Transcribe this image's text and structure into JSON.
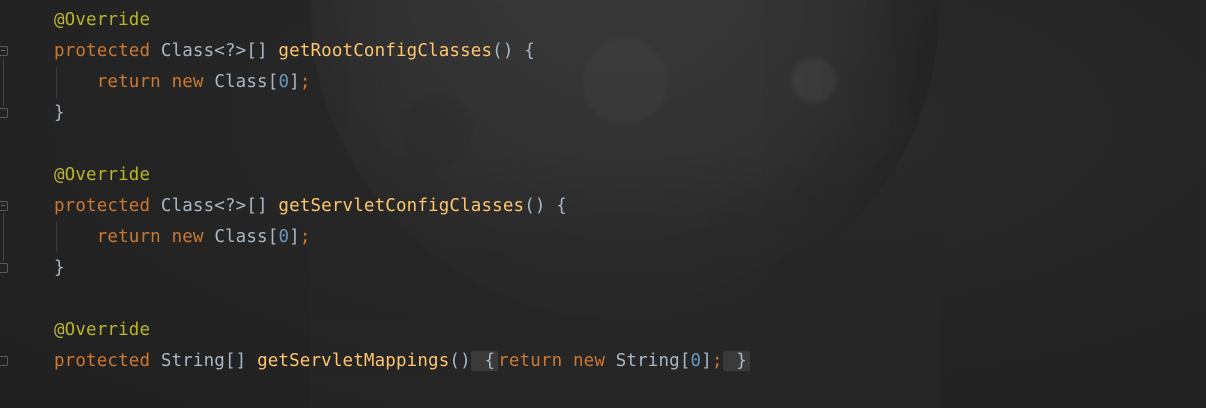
{
  "code": {
    "blocks": [
      {
        "annotation": "@Override",
        "modifier": "protected",
        "return_type": "Class<?>[]",
        "method_name": "getRootConfigClasses",
        "params": "()",
        "open_brace": "{",
        "body_keyword_return": "return",
        "body_keyword_new": "new",
        "body_type": "Class[",
        "body_index": "0",
        "body_close": "]",
        "body_semi": ";",
        "close_brace": "}"
      },
      {
        "annotation": "@Override",
        "modifier": "protected",
        "return_type": "Class<?>[]",
        "method_name": "getServletConfigClasses",
        "params": "()",
        "open_brace": "{",
        "body_keyword_return": "return",
        "body_keyword_new": "new",
        "body_type": "Class[",
        "body_index": "0",
        "body_close": "]",
        "body_semi": ";",
        "close_brace": "}"
      },
      {
        "annotation": "@Override",
        "modifier": "protected",
        "return_type": "String[]",
        "method_name": "getServletMappings",
        "params": "()",
        "open_brace": "{",
        "body_keyword_return": "return",
        "body_keyword_new": "new",
        "body_type": "String[",
        "body_index": "0",
        "body_close": "]",
        "body_semi": ";",
        "close_brace": "}"
      }
    ]
  },
  "theme": {
    "background": "#262626",
    "annotation_color": "#bbb529",
    "keyword_color": "#cc7832",
    "method_color": "#ffc66d",
    "number_color": "#6897bb",
    "text_color": "#a9b7c6"
  }
}
